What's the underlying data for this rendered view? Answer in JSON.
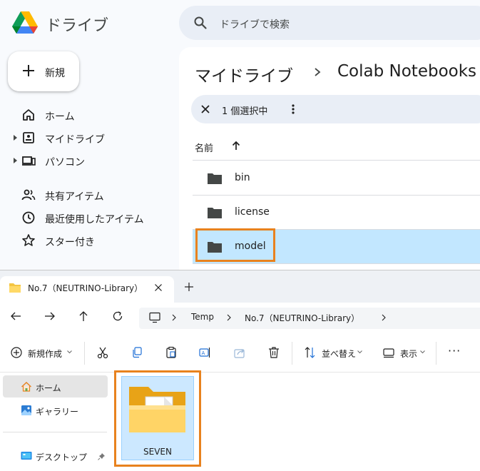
{
  "drive": {
    "brand": "ドライブ",
    "search_placeholder": "ドライブで検索",
    "new_button": "新規",
    "nav": [
      {
        "label": "ホーム",
        "icon": "home-icon"
      },
      {
        "label": "マイドライブ",
        "icon": "my-drive-icon"
      },
      {
        "label": "パソコン",
        "icon": "computers-icon"
      },
      {
        "label": "共有アイテム",
        "icon": "shared-icon"
      },
      {
        "label": "最近使用したアイテム",
        "icon": "clock-icon"
      },
      {
        "label": "スター付き",
        "icon": "star-icon"
      }
    ],
    "breadcrumb": [
      "マイドライブ",
      "Colab Notebooks"
    ],
    "selection_text": "1 個選択中",
    "column_name": "名前",
    "files": [
      {
        "name": "bin",
        "selected": false
      },
      {
        "name": "license",
        "selected": false
      },
      {
        "name": "model",
        "selected": true
      }
    ],
    "colors": {
      "selected_row": "#c2e7ff",
      "highlight": "#e8821e"
    }
  },
  "explorer": {
    "tab_title": "No.7（NEUTRINO-Library）",
    "address": [
      "Temp",
      "No.7（NEUTRINO-Library）"
    ],
    "commands": {
      "new": "新規作成",
      "sort": "並べ替え",
      "view": "表示",
      "more": "···"
    },
    "sidebar": [
      {
        "label": "ホーム",
        "icon": "home-icon",
        "selected": true
      },
      {
        "label": "ギャラリー",
        "icon": "gallery-icon",
        "selected": false
      },
      {
        "label": "デスクトップ",
        "icon": "desktop-icon",
        "selected": false
      }
    ],
    "items": [
      {
        "name": "SEVEN",
        "type": "folder",
        "selected": true
      }
    ]
  }
}
